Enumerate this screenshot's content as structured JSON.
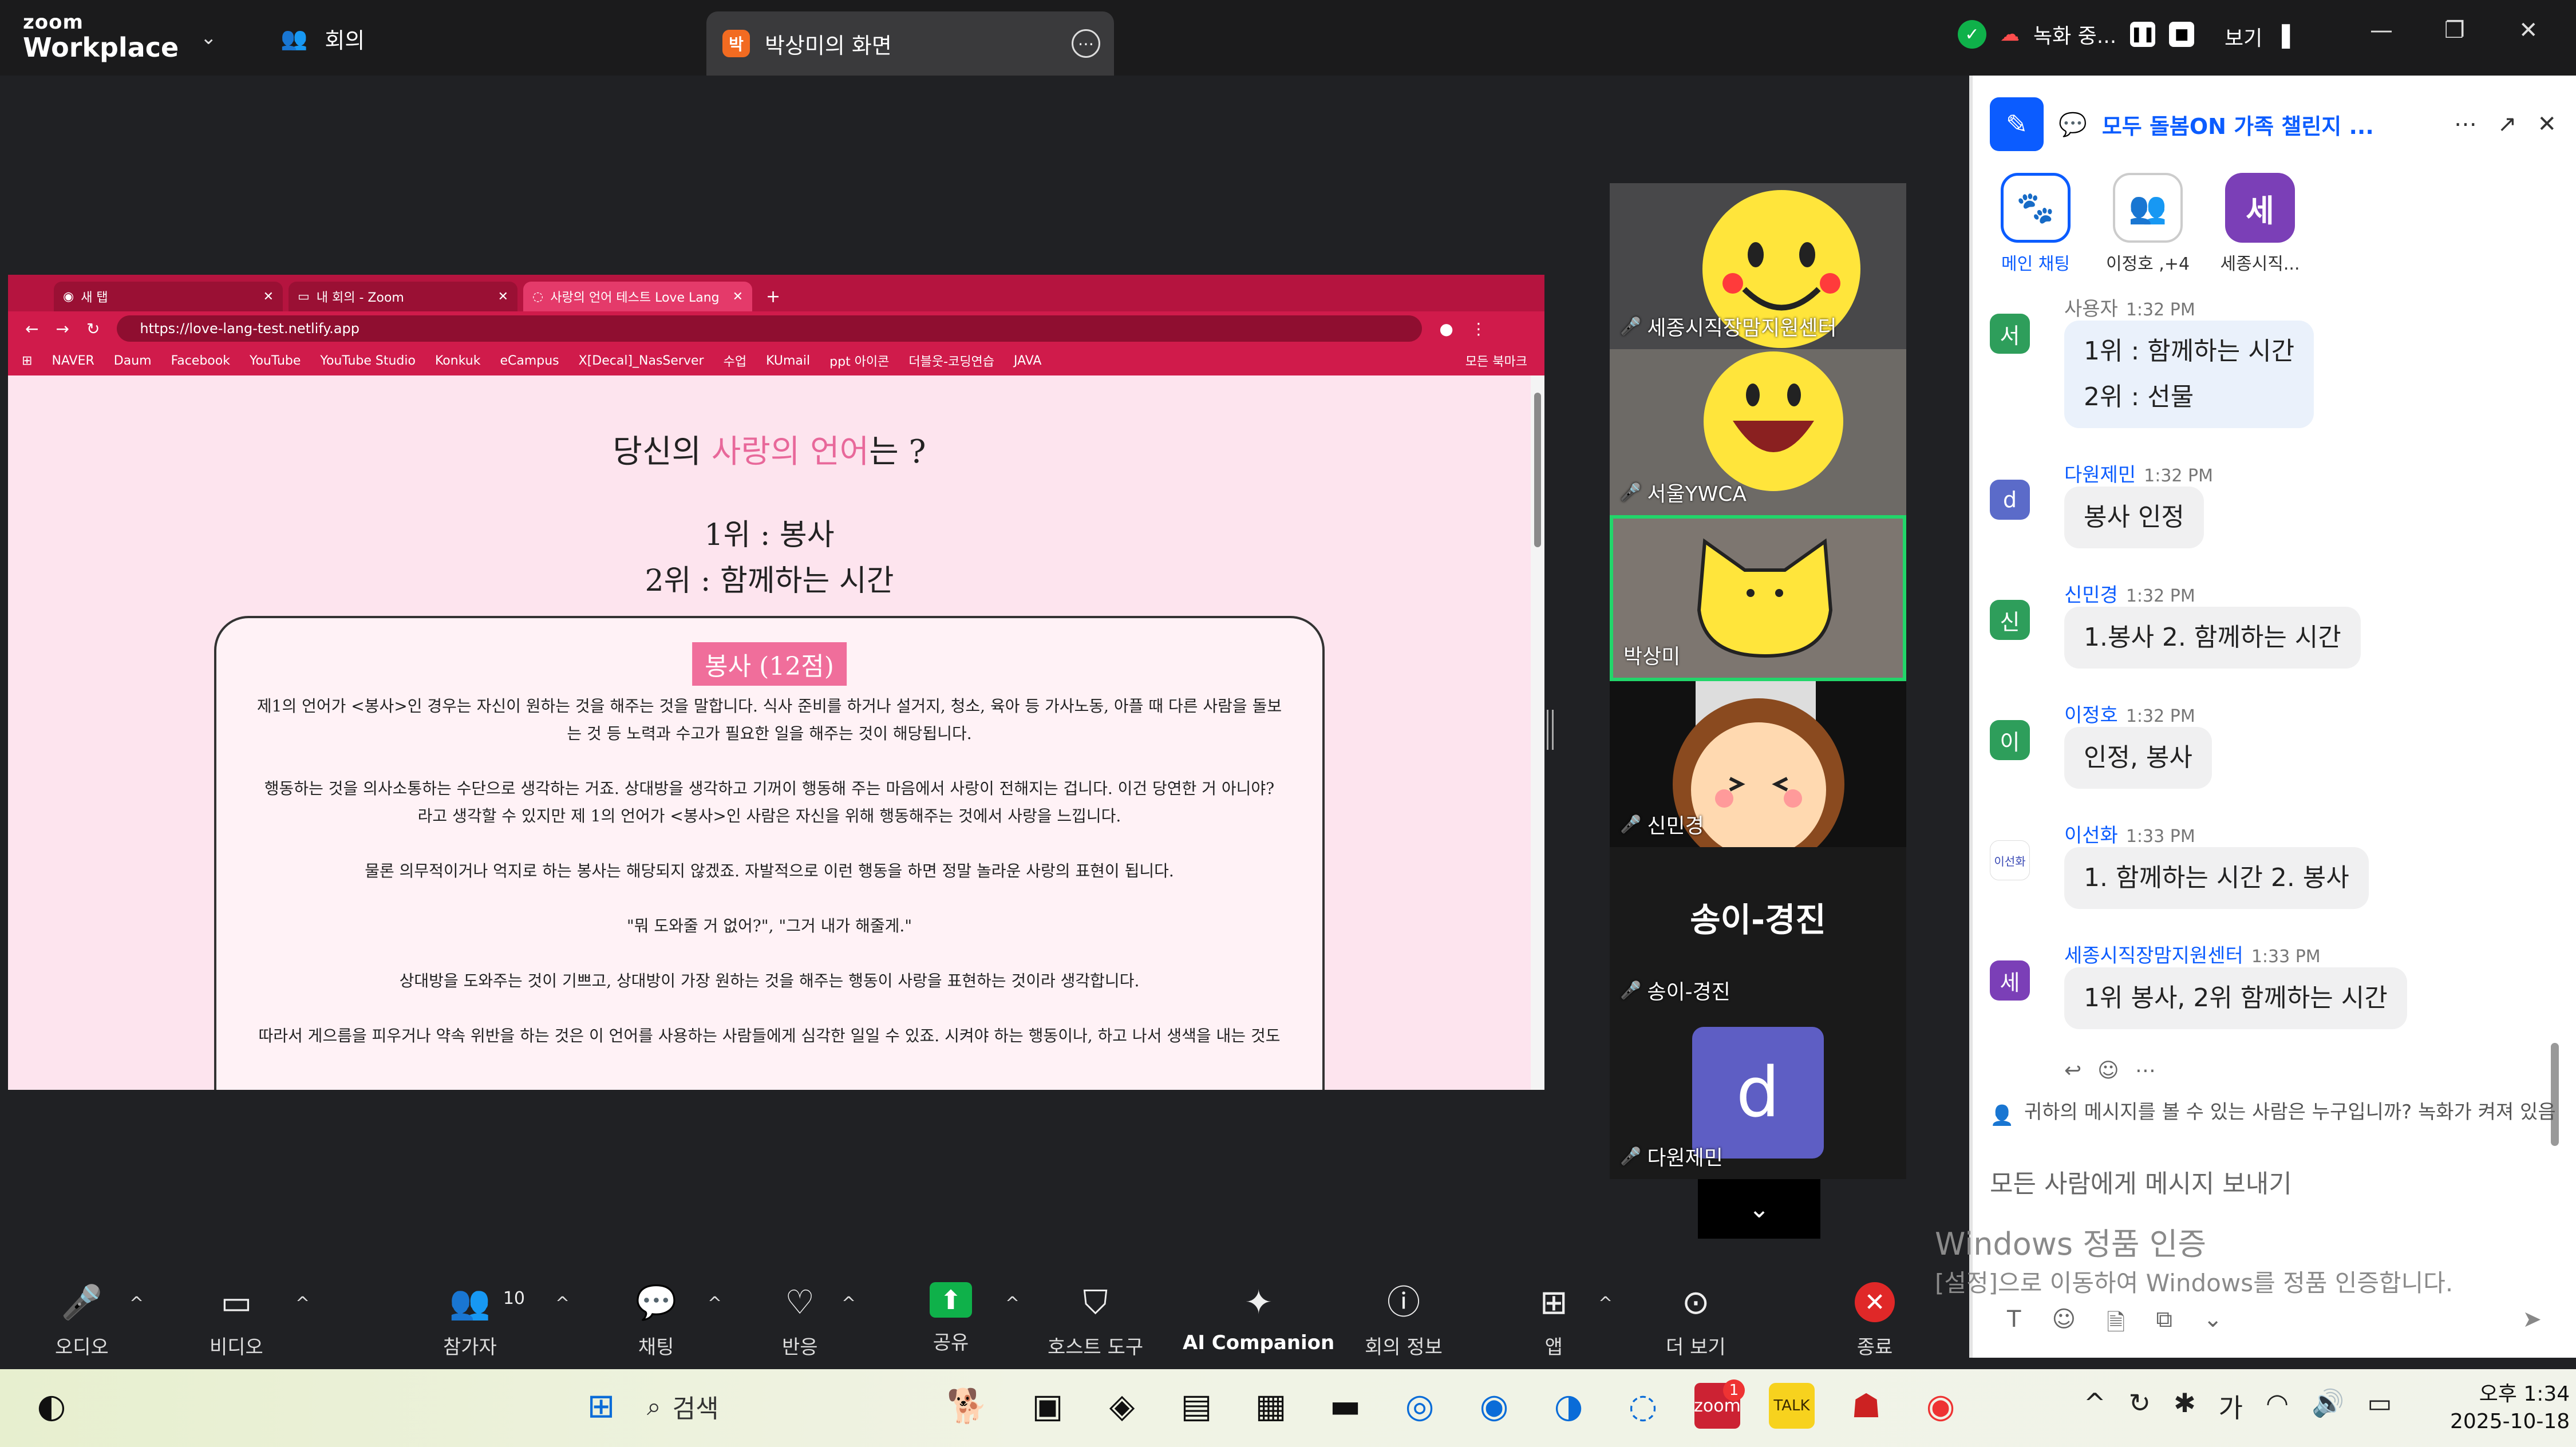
{
  "titlebar": {
    "logo_top": "zoom",
    "logo_bottom": "Workplace",
    "meeting_label": "회의",
    "share_badge": "박",
    "share_title": "박상미의 화면",
    "recording_label": "녹화 중...",
    "view_label": "보기"
  },
  "browser": {
    "tabs": [
      "새 탭",
      "내 회의 - Zoom",
      "사랑의 언어 테스트 Love Lang"
    ],
    "url": "https://love-lang-test.netlify.app",
    "bookmarks": [
      "NAVER",
      "Daum",
      "Facebook",
      "YouTube",
      "YouTube Studio",
      "Konkuk",
      "eCampus",
      "X[Decal]_NasServer",
      "수업",
      "KUmail",
      "ppt 아이콘",
      "더블웃-코딩연습",
      "JAVA"
    ],
    "all_bookmarks": "모든 북마크"
  },
  "page": {
    "headline_pre": "당신의 ",
    "headline_pink": "사랑의 언어",
    "headline_post": "는 ?",
    "rank1": "1위 : 봉사",
    "rank2": "2위 : 함께하는 시간",
    "card_title": "봉사 (12점)",
    "p1": "제1의 언어가 <봉사>인 경우는 자신이 원하는 것을 해주는 것을 말합니다. 식사 준비를 하거나 설거지, 청소, 육아 등 가사노동, 아플 때 다른 사람을 돌보는 것 등 노력과 수고가 필요한 일을 해주는 것이 해당됩니다.",
    "p2": "행동하는 것을 의사소통하는 수단으로 생각하는 거죠. 상대방을 생각하고 기꺼이 행동해 주는 마음에서 사랑이 전해지는 겁니다. 이건 당연한 거 아니야? 라고 생각할 수 있지만 제 1의 언어가 <봉사>인 사람은 자신을 위해 행동해주는 것에서 사랑을 느낍니다.",
    "p3": "물론 의무적이거나 억지로 하는 봉사는 해당되지 않겠죠. 자발적으로 이런 행동을 하면 정말 놀라운 사랑의 표현이 됩니다.",
    "p4": "\"뭐 도와줄 거 없어?\", \"그거 내가 해줄게.\"",
    "p5": "상대방을 도와주는 것이 기쁘고, 상대방이 가장 원하는 것을 해주는 행동이 사랑을 표현하는 것이라 생각합니다.",
    "p6": "따라서 게으름을 피우거나 약속 위반을 하는 것은 이 언어를 사용하는 사람들에게 심각한 일일 수 있죠. 시켜야 하는 행동이나, 하고 나서 생색을 내는 것도"
  },
  "participants": [
    {
      "name": "세종시직장맘지원센터"
    },
    {
      "name": "서울YWCA"
    },
    {
      "name": "박상미"
    },
    {
      "name": "신민경"
    },
    {
      "name": "송이-경진",
      "big": "송이-경진"
    },
    {
      "name": "다원제민",
      "avatar": "d"
    }
  ],
  "chat": {
    "title": "모두 돌봄ON 가족 챌린지 ...",
    "rooms": [
      {
        "label": "메인 채팅"
      },
      {
        "label": "이정호 ,+4"
      },
      {
        "label": "세종시직...",
        "initial": "세"
      }
    ],
    "messages": [
      {
        "sender": "사용자",
        "time": "1:32 PM",
        "avatar": "서",
        "color": "#2e9e5b",
        "lines": [
          "1위 : 함께하는 시간",
          "2위 : 선물"
        ]
      },
      {
        "sender": "다원제민",
        "time": "1:32 PM",
        "avatar": "d",
        "color": "#5b6bc9",
        "lines": [
          "봉사 인정"
        ]
      },
      {
        "sender": "신민경",
        "time": "1:32 PM",
        "avatar": "신",
        "color": "#2e9e5b",
        "lines": [
          "1.봉사 2. 함께하는 시간"
        ]
      },
      {
        "sender": "이정호",
        "time": "1:32 PM",
        "avatar": "이",
        "color": "#2e9e5b",
        "lines": [
          "인정, 봉사"
        ]
      },
      {
        "sender": "이선화",
        "time": "1:33 PM",
        "avatar": "이선화",
        "color": "#ffffff",
        "lines": [
          "1. 함께하는 시간 2. 봉사"
        ]
      },
      {
        "sender": "세종시직장맘지원센터",
        "time": "1:33 PM",
        "avatar": "세",
        "color": "#7b3fb7",
        "lines": [
          "1위 봉사, 2위 함께하는 시간"
        ]
      }
    ],
    "who_can_see": "귀하의 메시지를 볼 수 있는 사람은 누구입니까? 녹화가 켜져 있음",
    "input_placeholder": "모든 사람에게 메시지 보내기"
  },
  "windows_activation": {
    "title": "Windows 정품 인증",
    "sub": "[설정]으로 이동하여 Windows를 정품 인증합니다."
  },
  "toolbar": {
    "audio": "오디오",
    "video": "비디오",
    "participants": "참가자",
    "participant_count": "10",
    "chat": "채팅",
    "react": "반응",
    "share": "공유",
    "host_tools": "호스트 도구",
    "ai": "AI Companion",
    "info": "회의 정보",
    "apps": "앱",
    "more": "더 보기",
    "end": "종료"
  },
  "taskbar": {
    "search": "검색",
    "zoom_badge": "1",
    "clock_time": "오후 1:34",
    "clock_date": "2025-10-18",
    "ime": "가"
  }
}
